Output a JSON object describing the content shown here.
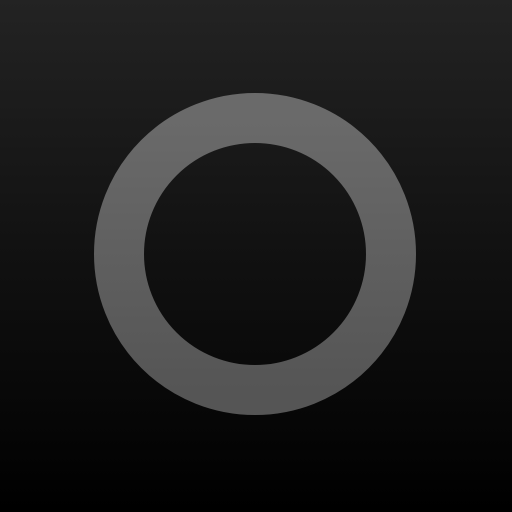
{
  "icon": {
    "name": "circle-ring-icon",
    "background_top": "#232323",
    "background_bottom": "#000000",
    "ring_color_top": "#6a6a6a",
    "ring_color_bottom": "#555555"
  }
}
